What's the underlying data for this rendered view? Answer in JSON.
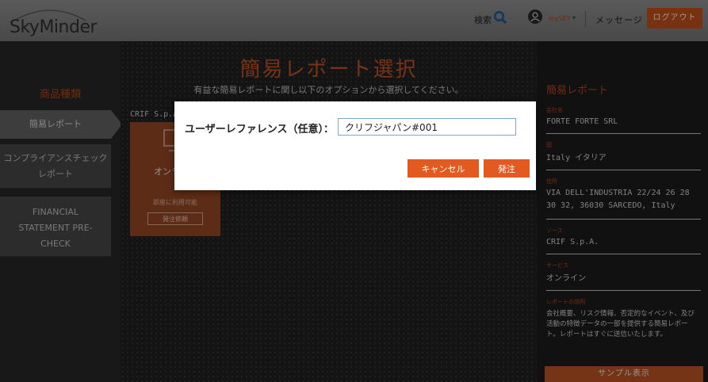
{
  "header": {
    "logo": "SkyMinder",
    "search_label": "検索",
    "mysky_label": "mySKY",
    "message_label": "メッセージ",
    "logout_label": "ログアウト"
  },
  "sidebar": {
    "title": "商品種類",
    "items": [
      {
        "label": "簡易レポート",
        "active": true
      },
      {
        "label": "コンプライアンスチェックレポート",
        "active": false
      },
      {
        "label": "FINANCIAL STATEMENT PRE-CHECK",
        "active": false
      }
    ]
  },
  "main": {
    "title": "簡易レポート選択",
    "subtitle": "有益な簡易レポートに関し以下のオプションから選択してください。",
    "provider": "CRIF S.p.A.",
    "card": {
      "name": "オンライン",
      "availability": "即座に利用可能",
      "order_button": "発注依頼"
    }
  },
  "right_panel": {
    "title": "簡易レポート",
    "company_label": "会社名",
    "company_value": "FORTE FORTE SRL",
    "country_label": "国",
    "country_value": "Italy イタリア",
    "address_label": "住所",
    "address_value": "VIA DELL'INDUSTRIA 22/24 26 28 30 32, 36030 SARCEDO, Italy",
    "source_label": "ソース",
    "source_value": "CRIF S.p.A.",
    "service_label": "サービス",
    "service_value": "オンライン",
    "description_label": "レポートの説明",
    "description_value": "会社概要、リスク情報、否定的なイベント、及び活動の特徴データの一部を提供する簡易レポート。レポートはすぐに送信いたします。",
    "sample_button": "サンプル表示"
  },
  "modal": {
    "label": "ユーザーレファレンス（任意）：",
    "input_value": "クリフジャパン#001",
    "cancel_label": "キャンセル",
    "send_label": "発注"
  },
  "colors": {
    "accent": "#e35a21",
    "header_bg": "#8e8e8e",
    "input_border": "#7fa7d6"
  }
}
